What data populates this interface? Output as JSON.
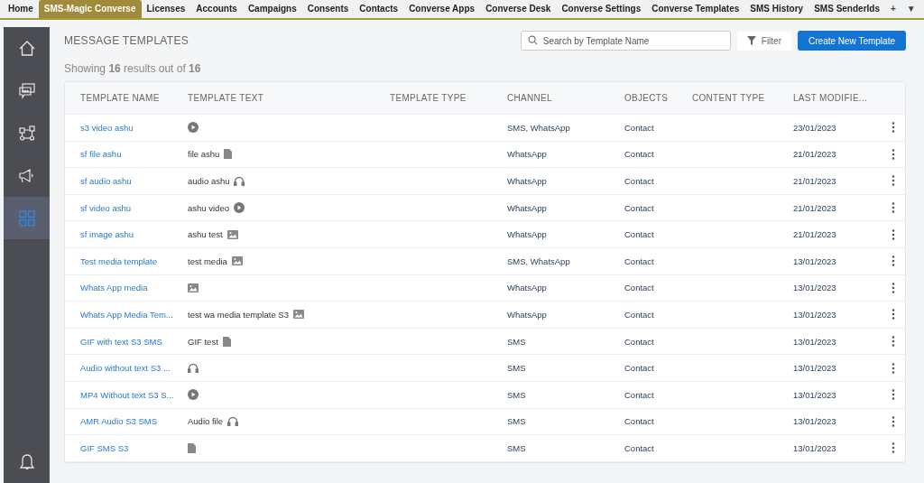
{
  "tabs": [
    {
      "label": "Home",
      "selected": false
    },
    {
      "label": "SMS-Magic Converse",
      "selected": true
    },
    {
      "label": "Licenses",
      "selected": false
    },
    {
      "label": "Accounts",
      "selected": false
    },
    {
      "label": "Campaigns",
      "selected": false
    },
    {
      "label": "Consents",
      "selected": false
    },
    {
      "label": "Contacts",
      "selected": false
    },
    {
      "label": "Converse Apps",
      "selected": false
    },
    {
      "label": "Converse Desk",
      "selected": false
    },
    {
      "label": "Converse Settings",
      "selected": false
    },
    {
      "label": "Converse Templates",
      "selected": false
    },
    {
      "label": "SMS History",
      "selected": false
    },
    {
      "label": "SMS SenderIds",
      "selected": false
    }
  ],
  "tab_extras": [
    "+",
    "▼"
  ],
  "sidebar": {
    "items": [
      {
        "kind": "home",
        "selected": false
      },
      {
        "kind": "chat",
        "selected": false
      },
      {
        "kind": "flow",
        "selected": false
      },
      {
        "kind": "megaphone",
        "selected": false
      },
      {
        "kind": "grid",
        "selected": true
      }
    ],
    "bottom": {
      "kind": "bell"
    }
  },
  "page_title": "MESSAGE TEMPLATES",
  "summary": "Showing **16** results out of **16**",
  "search": {
    "placeholder": "Search by Template Name"
  },
  "filter_button": "Filter",
  "create_button": "Create New Template",
  "table": {
    "columns": [
      "TEMPLATE NAME",
      "TEMPLATE TEXT",
      "TEMPLATE TYPE",
      "CHANNEL",
      "OBJECTS",
      "CONTENT TYPE",
      "LAST MODIFIE..."
    ],
    "rows": [
      {
        "name": "s3 video ashu",
        "text": "",
        "kind": "video",
        "channel": "SMS, WhatsApp",
        "object": "Contact",
        "modified": "23/01/2023"
      },
      {
        "name": "sf file ashu",
        "text": "file ashu",
        "kind": "file",
        "channel": "WhatsApp",
        "object": "Contact",
        "modified": "21/01/2023"
      },
      {
        "name": "sf audio ashu",
        "text": "audio ashu",
        "kind": "audio",
        "channel": "WhatsApp",
        "object": "Contact",
        "modified": "21/01/2023"
      },
      {
        "name": "sf video ashu",
        "text": "ashu video",
        "kind": "video",
        "channel": "WhatsApp",
        "object": "Contact",
        "modified": "21/01/2023"
      },
      {
        "name": "sf image ashu",
        "text": "ashu test",
        "kind": "image",
        "channel": "WhatsApp",
        "object": "Contact",
        "modified": "21/01/2023"
      },
      {
        "name": "Test media template",
        "text": "test media",
        "kind": "image",
        "channel": "SMS, WhatsApp",
        "object": "Contact",
        "modified": "13/01/2023"
      },
      {
        "name": "Whats App media",
        "text": "",
        "kind": "image",
        "channel": "WhatsApp",
        "object": "Contact",
        "modified": "13/01/2023"
      },
      {
        "name": "Whats App Media Tem...",
        "text": "test wa media template S3",
        "kind": "image",
        "channel": "WhatsApp",
        "object": "Contact",
        "modified": "13/01/2023"
      },
      {
        "name": "GIF with text S3 SMS",
        "text": "GIF test",
        "kind": "file",
        "channel": "SMS",
        "object": "Contact",
        "modified": "13/01/2023"
      },
      {
        "name": "Audio without text S3 ...",
        "text": "",
        "kind": "audio",
        "channel": "SMS",
        "object": "Contact",
        "modified": "13/01/2023"
      },
      {
        "name": "MP4 Without text S3 S...",
        "text": "",
        "kind": "video",
        "channel": "SMS",
        "object": "Contact",
        "modified": "13/01/2023"
      },
      {
        "name": "AMR Audio S3 SMS",
        "text": "Audio file",
        "kind": "audio",
        "channel": "SMS",
        "object": "Contact",
        "modified": "13/01/2023"
      },
      {
        "name": "GIF SMS S3",
        "text": "",
        "kind": "file",
        "channel": "SMS",
        "object": "Contact",
        "modified": "13/01/2023"
      }
    ]
  }
}
